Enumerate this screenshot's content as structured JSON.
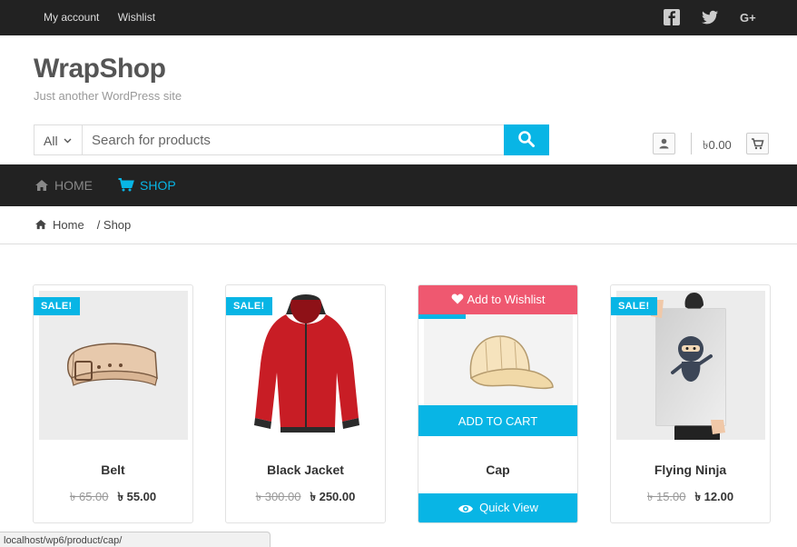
{
  "topbar": {
    "links": [
      "My account",
      "Wishlist"
    ],
    "social_icons": [
      "facebook-icon",
      "twitter-icon",
      "google-plus-icon"
    ]
  },
  "header": {
    "brand": "WrapShop",
    "tagline": "Just another WordPress site"
  },
  "search": {
    "category": "All",
    "placeholder": "Search for products"
  },
  "cart": {
    "total": "৳0.00"
  },
  "nav": {
    "home": "HOME",
    "shop": "SHOP"
  },
  "breadcrumb": {
    "home": "Home",
    "current": "/ Shop"
  },
  "products": [
    {
      "name": "Belt",
      "old_price": "৳ 65.00",
      "price": "৳ 55.00",
      "badge": "SALE!"
    },
    {
      "name": "Black Jacket",
      "old_price": "৳ 300.00",
      "price": "৳ 250.00",
      "badge": "SALE!"
    },
    {
      "name": "Cap",
      "wishlist_label": "Add to Wishlist",
      "add_to_cart": "ADD TO CART",
      "quick_view": "Quick View"
    },
    {
      "name": "Flying Ninja",
      "old_price": "৳ 15.00",
      "price": "৳ 12.00",
      "badge": "SALE!"
    }
  ],
  "status_url": "localhost/wp6/product/cap/",
  "colors": {
    "accent": "#08b5e5",
    "dark": "#222222",
    "wishlist": "#ef5870"
  }
}
